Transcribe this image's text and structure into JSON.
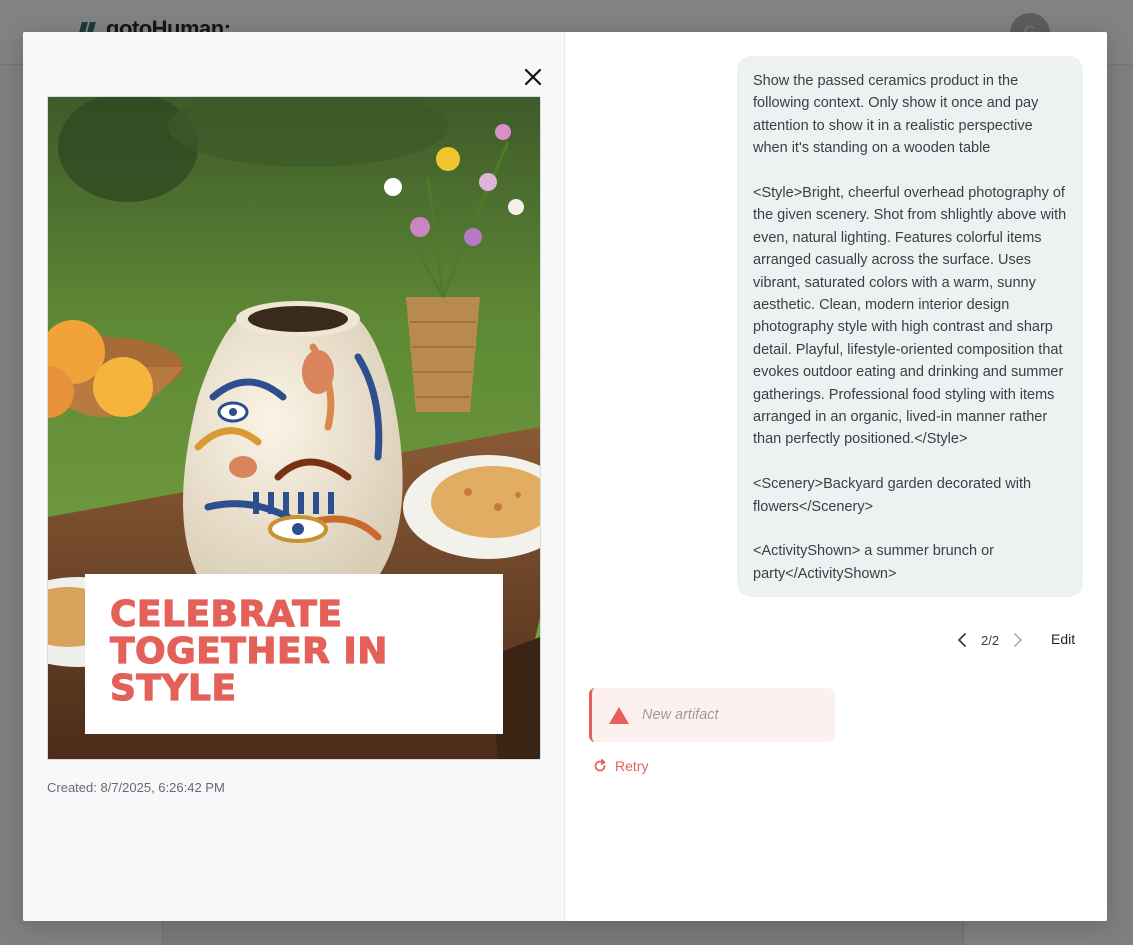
{
  "background": {
    "logo_text": "gotoHuman:",
    "avatar_initial": "G"
  },
  "modal": {
    "close_icon": "close-icon",
    "artifact": {
      "headline": "CELEBRATE TOGETHER IN STYLE",
      "created": "Created: 8/7/2025, 6:26:42 PM"
    },
    "prompt": {
      "paragraphs": [
        "Show the passed ceramics product in the following context. Only show it once and pay attention to show it in a realistic perspective when it's standing on a wooden table",
        "<Style>Bright, cheerful overhead photography of the given scenery. Shot from shlightly above with even, natural lighting. Features colorful items arranged casually across the surface. Uses vibrant, saturated colors with a warm, sunny aesthetic. Clean, modern interior design photography style with high contrast and sharp detail. Playful, lifestyle-oriented composition that evokes outdoor eating and drinking and summer gatherings. Professional food styling with items arranged in an organic, lived-in manner rather than perfectly positioned.</Style>",
        "<Scenery>Backyard garden decorated with flowers</Scenery>",
        "<ActivityShown> a summer brunch or party</ActivityShown>"
      ]
    },
    "pager": {
      "count": "2/2",
      "edit_label": "Edit"
    },
    "result": {
      "label": "New artifact",
      "retry_label": "Retry"
    },
    "colors": {
      "accent": "#e4615a",
      "bubble_bg": "#eef1f1",
      "error_bg": "#fdf1ef"
    }
  }
}
